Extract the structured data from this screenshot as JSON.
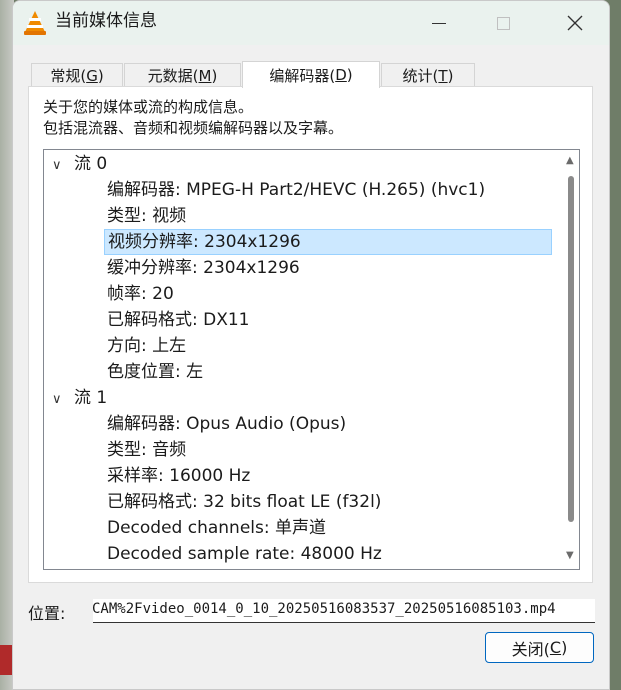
{
  "window": {
    "title": "当前媒体信息"
  },
  "tabs": [
    {
      "label": "常规(",
      "key": "G",
      "end": ")"
    },
    {
      "label": "元数据(",
      "key": "M",
      "end": ")"
    },
    {
      "label": "编解码器(",
      "key": "D",
      "end": ")"
    },
    {
      "label": "统计(",
      "key": "T",
      "end": ")"
    }
  ],
  "description": {
    "line1": "关于您的媒体或流的构成信息。",
    "line2": "包括混流器、音频和视频编解码器以及字幕。"
  },
  "tree": {
    "stream0": {
      "label": "流 0",
      "items": [
        "编解码器: MPEG-H Part2/HEVC (H.265) (hvc1)",
        "类型: 视频",
        "视频分辨率: 2304x1296",
        "缓冲分辨率: 2304x1296",
        "帧率: 20",
        "已解码格式: DX11",
        "方向: 上左",
        "色度位置: 左"
      ]
    },
    "stream1": {
      "label": "流 1",
      "items": [
        "编解码器: Opus Audio (Opus)",
        "类型: 音频",
        "采样率: 16000 Hz",
        "已解码格式: 32 bits float LE (f32l)",
        "Decoded channels: 单声道",
        "Decoded sample rate: 48000 Hz"
      ]
    }
  },
  "location": {
    "label": "位置:",
    "value": "CAM%2Fvideo_0014_0_10_20250516083537_20250516085103.mp4"
  },
  "buttons": {
    "close_label": "关闭(",
    "close_key": "C",
    "close_end": ")"
  },
  "colors": {
    "selection": "#cce8ff",
    "accent": "#0067c0"
  }
}
